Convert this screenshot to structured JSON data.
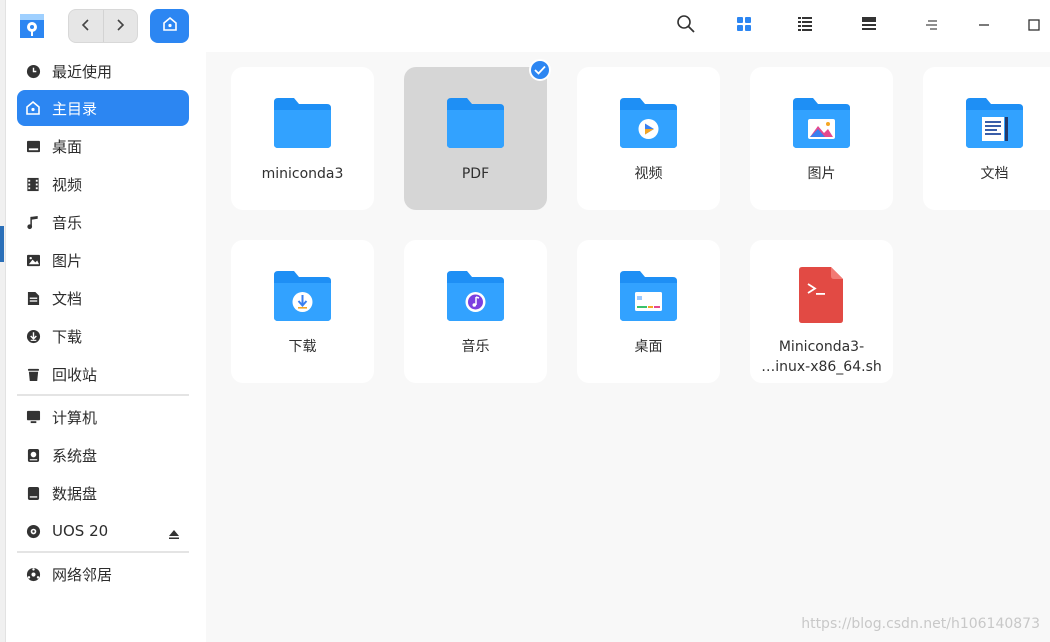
{
  "window": {
    "title_icon": "file-manager-icon",
    "nav_back": "chevron-left-icon",
    "nav_forward": "chevron-right-icon",
    "home": "home-icon"
  },
  "toolbar": {
    "search": "search-icon",
    "icon_view": "grid-view-icon",
    "list_view": "list-view-icon",
    "detail_view": "detail-view-icon",
    "menu": "menu-icon",
    "minimize": "minimize-icon",
    "maximize": "maximize-icon"
  },
  "sidebar": {
    "items": [
      {
        "label": "最近使用",
        "icon": "clock-icon"
      },
      {
        "label": "主目录",
        "icon": "home-icon",
        "active": true
      },
      {
        "label": "桌面",
        "icon": "desktop-icon"
      },
      {
        "label": "视频",
        "icon": "video-icon"
      },
      {
        "label": "音乐",
        "icon": "music-icon"
      },
      {
        "label": "图片",
        "icon": "picture-icon"
      },
      {
        "label": "文档",
        "icon": "document-icon"
      },
      {
        "label": "下载",
        "icon": "download-icon"
      },
      {
        "label": "回收站",
        "icon": "trash-icon"
      }
    ],
    "devices": [
      {
        "label": "计算机",
        "icon": "computer-icon"
      },
      {
        "label": "系统盘",
        "icon": "system-disk-icon"
      },
      {
        "label": "数据盘",
        "icon": "data-disk-icon"
      },
      {
        "label": "UOS 20",
        "icon": "optical-disc-icon",
        "eject": "eject-icon"
      }
    ],
    "network": [
      {
        "label": "网络邻居",
        "icon": "network-icon"
      }
    ]
  },
  "files": [
    {
      "name": "miniconda3",
      "type": "folder"
    },
    {
      "name": "PDF",
      "type": "folder",
      "selected": true
    },
    {
      "name": "视频",
      "type": "video-folder"
    },
    {
      "name": "图片",
      "type": "picture-folder"
    },
    {
      "name": "文档",
      "type": "document-folder"
    },
    {
      "name": "下载",
      "type": "download-folder"
    },
    {
      "name": "音乐",
      "type": "music-folder"
    },
    {
      "name": "桌面",
      "type": "desktop-folder"
    },
    {
      "name_line1": "Miniconda3-",
      "name_line2": "…inux-x86_64.sh",
      "type": "shell-script"
    }
  ],
  "colors": {
    "accent": "#2c86f2",
    "folder_blue": "#1e8ff5",
    "script_red": "#e24a44",
    "selected_tile": "#d6d6d6"
  },
  "watermark": "https://blog.csdn.net/h106140873"
}
